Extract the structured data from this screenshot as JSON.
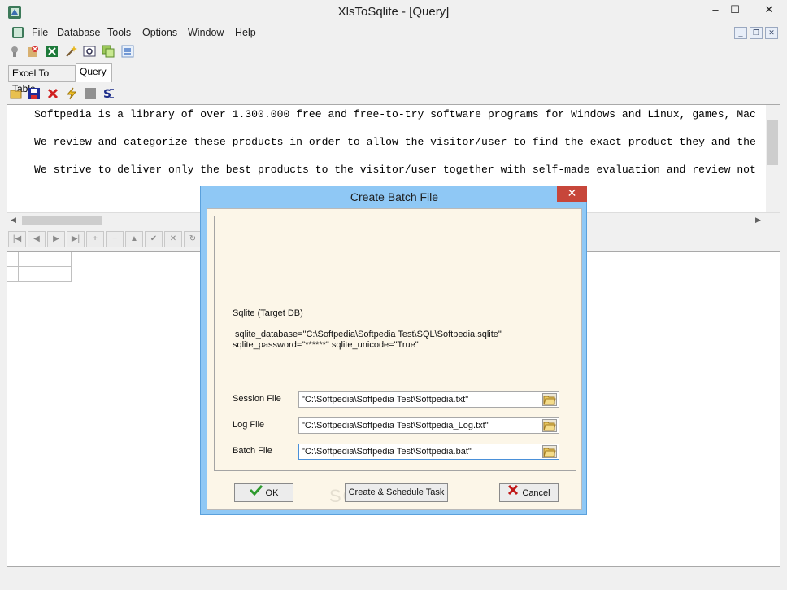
{
  "window": {
    "title": "XlsToSqlite - [Query]",
    "minimize": "–",
    "restore": "☐",
    "close": "✕"
  },
  "menu": {
    "items": [
      "File",
      "Database",
      "Tools",
      "Options",
      "Window",
      "Help"
    ],
    "mdi_minimize": "_",
    "mdi_restore": "❐",
    "mdi_close": "✕"
  },
  "toolbar1": {
    "icons": [
      "connect-icon",
      "disconnect-icon",
      "excel-icon",
      "wand-icon",
      "settings-icon",
      "copy-icon",
      "list-icon"
    ]
  },
  "tabs": [
    "Excel To Table",
    "Query"
  ],
  "active_tab": "Query",
  "toolbar2": {
    "icons": [
      "open-icon",
      "save-icon",
      "delete-icon",
      "execute-icon",
      "stop-icon",
      "sql-icon"
    ]
  },
  "editor": {
    "lines": [
      "Softpedia is a library of over 1.300.000 free and free-to-try software programs for Windows and Linux, games, Mac",
      "We review and categorize these products in order to allow the visitor/user to find the exact product they and the",
      "We strive to deliver only the best products to the visitor/user together with self-made evaluation and review not"
    ]
  },
  "navigator": {
    "buttons": [
      "|◀",
      "◀",
      "▶",
      "▶|",
      "+",
      "−",
      "▲",
      "✔",
      "✕",
      "↻"
    ]
  },
  "dialog": {
    "title": "Create Batch File",
    "close": "✕",
    "target_label": "Sqlite (Target DB)",
    "connection_line1": " sqlite_database=\"C:\\Softpedia\\Softpedia Test\\SQL\\Softpedia.sqlite\"",
    "connection_line2": "sqlite_password=\"******\" sqlite_unicode=\"True\"",
    "fields": [
      {
        "label": "Session File",
        "value": "\"C:\\Softpedia\\Softpedia Test\\Softpedia.txt\""
      },
      {
        "label": "Log File",
        "value": "\"C:\\Softpedia\\Softpedia Test\\Softpedia_Log.txt\""
      },
      {
        "label": "Batch File",
        "value": "\"C:\\Softpedia\\Softpedia Test\\Softpedia.bat\""
      }
    ],
    "ok_label": "OK",
    "schedule_label": "Create & Schedule Task",
    "cancel_label": "Cancel",
    "watermark": "SOFTPEDIA"
  },
  "colors": {
    "dialog_frame": "#8fc8f5",
    "dialog_body": "#fcf6e8",
    "close_red": "#c7463a",
    "ok_green": "#2e9a2e",
    "cancel_red": "#c01818"
  }
}
